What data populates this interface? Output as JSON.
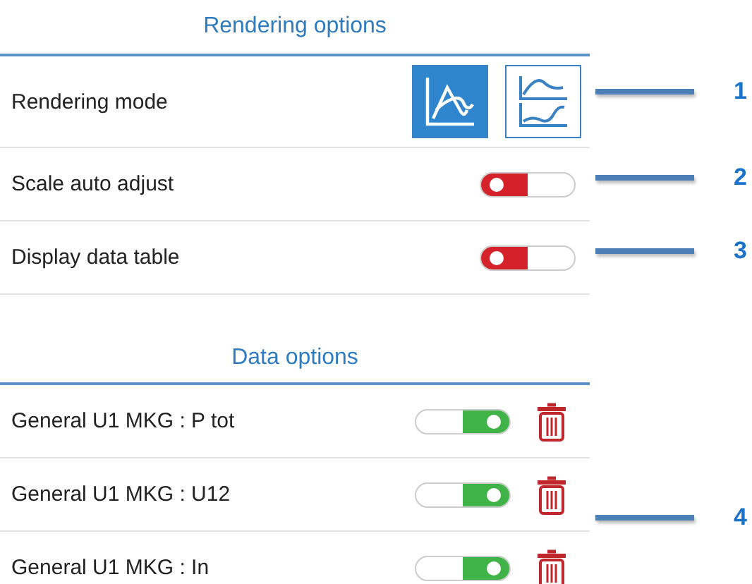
{
  "rendering_options": {
    "title": "Rendering options",
    "rows": [
      {
        "kind": "mode",
        "label": "Rendering mode",
        "modes": [
          {
            "kind": "overlay",
            "selected": true
          },
          {
            "kind": "stacked",
            "selected": false
          }
        ]
      },
      {
        "kind": "toggle",
        "label": "Scale auto adjust",
        "on": false
      },
      {
        "kind": "toggle",
        "label": "Display data table",
        "on": false
      }
    ]
  },
  "data_options": {
    "title": "Data options",
    "rows": [
      {
        "label": "General U1 MKG : P tot",
        "on": true
      },
      {
        "label": "General U1 MKG : U12",
        "on": true
      },
      {
        "label": "General U1 MKG : In",
        "on": true
      }
    ]
  },
  "callouts": [
    {
      "number": "1"
    },
    {
      "number": "2"
    },
    {
      "number": "3"
    },
    {
      "number": "4"
    }
  ]
}
